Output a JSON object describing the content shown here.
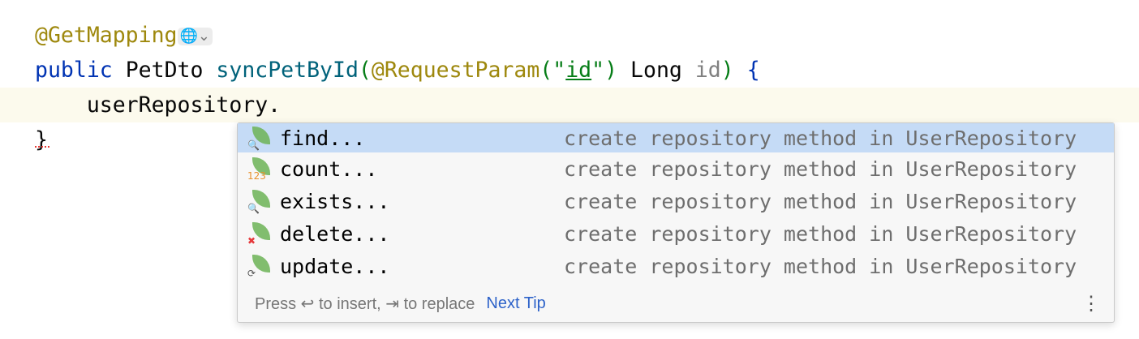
{
  "code": {
    "annotation": "@GetMapping",
    "line2": {
      "kw": "public",
      "type": "PetDto",
      "method": "syncPetById",
      "paren_open": "(",
      "param_ann": "@RequestParam",
      "q_open": "(\"",
      "param_value": "id",
      "q_close": "\")",
      "param_type": "Long",
      "param_name": "id",
      "paren_close": ")",
      "brace": "{"
    },
    "line3": "    userRepository.",
    "line4": "}"
  },
  "completion": {
    "items": [
      {
        "label": "find...",
        "description": "create repository method in UserRepository",
        "icon": "spring-find-icon",
        "badge": "🔍",
        "badge_color": "#e8912d"
      },
      {
        "label": "count...",
        "description": "create repository method in UserRepository",
        "icon": "spring-count-icon",
        "badge": "123",
        "badge_color": "#e8912d"
      },
      {
        "label": "exists...",
        "description": "create repository method in UserRepository",
        "icon": "spring-exists-icon",
        "badge": "🔍",
        "badge_color": "#e8912d"
      },
      {
        "label": "delete...",
        "description": "create repository method in UserRepository",
        "icon": "spring-delete-icon",
        "badge": "✖",
        "badge_color": "#e5383b"
      },
      {
        "label": "update...",
        "description": "create repository method in UserRepository",
        "icon": "spring-update-icon",
        "badge": "⟳",
        "badge_color": "#555555"
      }
    ],
    "footer": {
      "hint": "Press ↩ to insert, ⇥ to replace",
      "next_tip": "Next Tip",
      "more": "⋮"
    }
  }
}
